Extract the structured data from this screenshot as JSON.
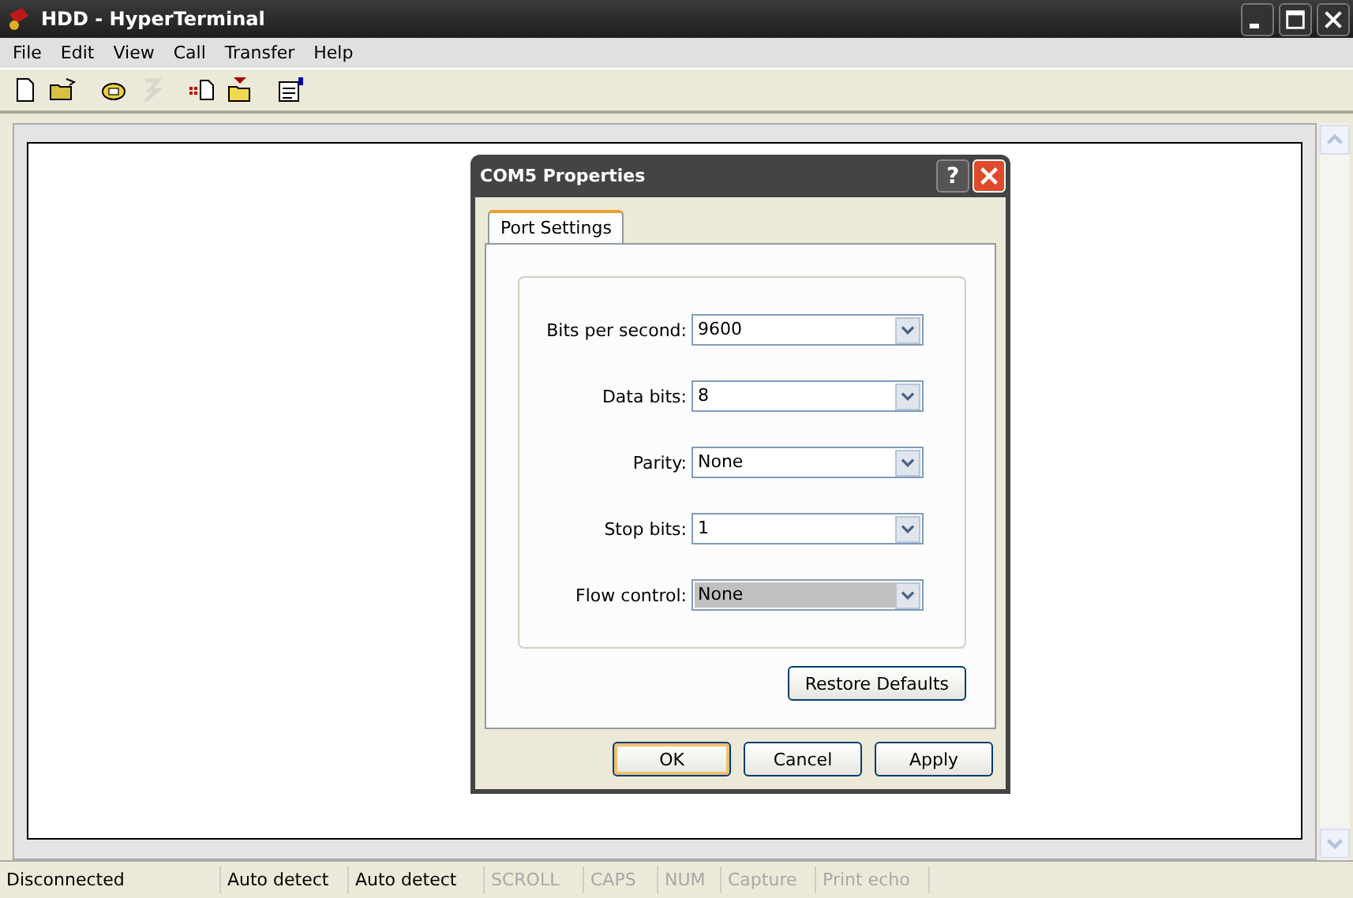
{
  "window": {
    "title": "HDD - HyperTerminal"
  },
  "menu": [
    "File",
    "Edit",
    "View",
    "Call",
    "Transfer",
    "Help"
  ],
  "toolbar": [
    {
      "kind": "new",
      "disabled": false
    },
    {
      "kind": "open",
      "disabled": false
    },
    {
      "kind": "call",
      "disabled": false
    },
    {
      "kind": "hangup",
      "disabled": true
    },
    {
      "kind": "send",
      "disabled": false
    },
    {
      "kind": "receive",
      "disabled": false
    },
    {
      "kind": "properties",
      "disabled": false
    }
  ],
  "dialog": {
    "title": "COM5 Properties",
    "help_button": "?",
    "tabs": [
      {
        "label": "Port Settings",
        "selected": true
      }
    ],
    "fields": [
      {
        "label": "Bits per second:",
        "value": "9600",
        "focused": false
      },
      {
        "label": "Data bits:",
        "value": "8",
        "focused": false
      },
      {
        "label": "Parity:",
        "value": "None",
        "focused": false
      },
      {
        "label": "Stop bits:",
        "value": "1",
        "focused": false
      },
      {
        "label": "Flow control:",
        "value": "None",
        "focused": true
      }
    ],
    "restore_button": "Restore Defaults",
    "buttons": [
      {
        "label": "OK",
        "default": true
      },
      {
        "label": "Cancel",
        "default": false
      },
      {
        "label": "Apply",
        "default": false
      }
    ]
  },
  "status_bar": [
    {
      "text": "Disconnected",
      "disabled": false
    },
    {
      "text": "Auto detect",
      "disabled": false
    },
    {
      "text": "Auto detect",
      "disabled": false
    },
    {
      "text": "SCROLL",
      "disabled": true
    },
    {
      "text": "CAPS",
      "disabled": true
    },
    {
      "text": "NUM",
      "disabled": true
    },
    {
      "text": "Capture",
      "disabled": true
    },
    {
      "text": "Print echo",
      "disabled": true
    }
  ]
}
